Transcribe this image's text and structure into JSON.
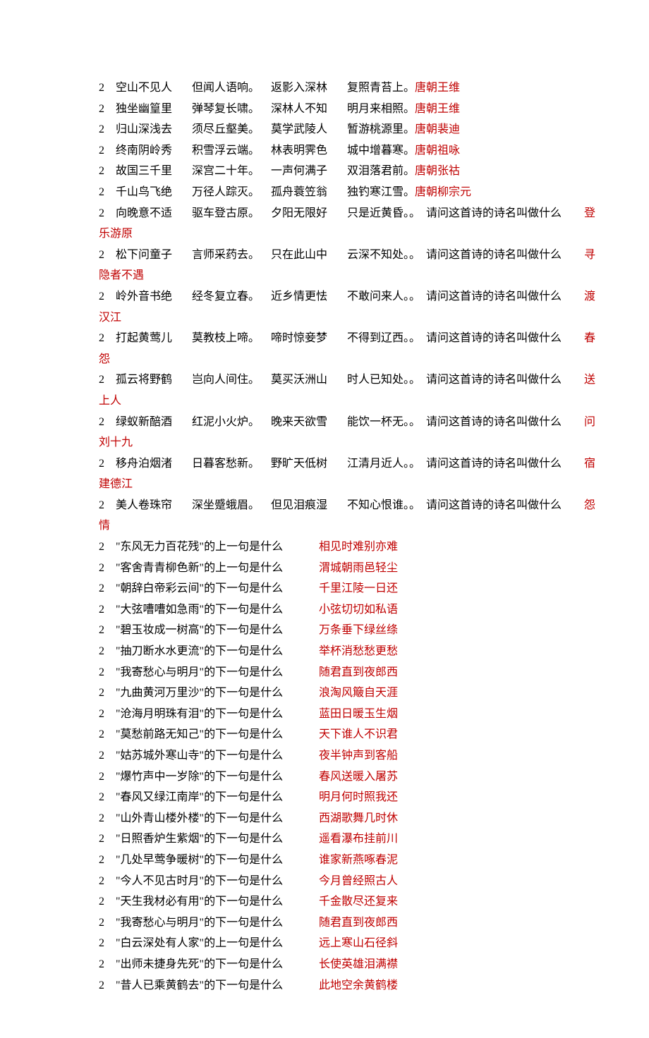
{
  "lines": [
    {
      "type": "author",
      "num": "2",
      "a": "空山不见人",
      "b": "但闻人语响。",
      "c": "返影入深林",
      "d": "复照青苔上。",
      "e": " 唐朝王维"
    },
    {
      "type": "author",
      "num": "2",
      "a": "独坐幽篁里",
      "b": "弹琴复长啸。",
      "c": "深林人不知",
      "d": "明月来相照。",
      "e": " 唐朝王维"
    },
    {
      "type": "author",
      "num": "2",
      "a": "归山深浅去",
      "b": "须尽丘壑美。",
      "c": "莫学武陵人",
      "d": "暂游桃源里。",
      "e": " 唐朝裴迪"
    },
    {
      "type": "author",
      "num": "2",
      "a": "终南阴岭秀",
      "b": "积雪浮云端。",
      "c": "林表明霁色",
      "d": "城中增暮寒。",
      "e": " 唐朝祖咏"
    },
    {
      "type": "author",
      "num": "2",
      "a": "故国三千里",
      "b": "深宫二十年。",
      "c": "一声何满子",
      "d": "双泪落君前。",
      "e": " 唐朝张祜"
    },
    {
      "type": "author",
      "num": "2",
      "a": "千山鸟飞绝",
      "b": "万径人踪灭。",
      "c": " 孤舟蓑笠翁",
      "d": "独钓寒江雪。",
      "e": " 唐朝柳宗元"
    },
    {
      "type": "title",
      "num": "2",
      "a": "向晚意不适",
      "b": "驱车登古原。",
      "c": "夕阳无限好",
      "d": "只是近黄昏。",
      "q": "请问这首诗的诗名叫做什么",
      "ans": "登乐游原"
    },
    {
      "type": "title",
      "num": "2",
      "a": "松下问童子",
      "b": "言师采药去。",
      "c": "只在此山中",
      "d": "云深不知处。",
      "q": "请问这首诗的诗名叫做什么",
      "ans": "寻隐者不遇"
    },
    {
      "type": "title",
      "num": "2",
      "a": "岭外音书绝",
      "b": "经冬复立春。",
      "c": "近乡情更怯",
      "d": "不敢问来人。",
      "q": "请问这首诗的诗名叫做什么",
      "ans": "渡汉江"
    },
    {
      "type": "title",
      "num": "2",
      "a": "打起黄莺儿",
      "b": "莫教枝上啼。",
      "c": "啼时惊妾梦",
      "d": "不得到辽西。",
      "q": "请问这首诗的诗名叫做什么",
      "ans": "春怨"
    },
    {
      "type": "title",
      "num": "2",
      "a": "孤云将野鹤",
      "b": "岂向人间住。",
      "c": "莫买沃洲山",
      "d": "时人已知处。",
      "q": "请问这首诗的诗名叫做什么",
      "ans": "送上人"
    },
    {
      "type": "title",
      "num": "2",
      "a": "绿蚁新醅酒",
      "b": "红泥小火炉。",
      "c": "晚来天欲雪",
      "d": "能饮一杯无。",
      "q": "请问这首诗的诗名叫做什么",
      "ans": "问刘十九"
    },
    {
      "type": "title",
      "num": "2",
      "a": "移舟泊烟渚",
      "b": "日暮客愁新。",
      "c": "野旷天低树",
      "d": "江清月近人。",
      "q": "请问这首诗的诗名叫做什么",
      "ans": "宿建德江"
    },
    {
      "type": "title",
      "num": "2",
      "a": "美人卷珠帘",
      "b": "深坐蹙蛾眉。",
      "c": "但见泪痕湿",
      "d": "不知心恨谁。",
      "q": "请问这首诗的诗名叫做什么",
      "ans": "怨情"
    },
    {
      "type": "verse",
      "num": "2",
      "q": "\"东风无力百花残\"的上一句是什么",
      "ans": "相见时难别亦难"
    },
    {
      "type": "verse",
      "num": "2",
      "q": "\"客舍青青柳色新\"的上一句是什么",
      "ans": "渭城朝雨邑轻尘"
    },
    {
      "type": "verse",
      "num": "2",
      "q": "\"朝辞白帝彩云间\"的下一句是什么",
      "ans": "千里江陵一日还"
    },
    {
      "type": "verse",
      "num": "2",
      "q": "\"大弦嘈嘈如急雨\"的下一句是什么",
      "ans": "小弦切切如私语"
    },
    {
      "type": "verse",
      "num": "2",
      "q": "\"碧玉妆成一树高\"的下一句是什么",
      "ans": "万条垂下绿丝绦"
    },
    {
      "type": "verse",
      "num": "2",
      "q": "\"抽刀断水水更流\"的下一句是什么",
      "ans": "举杯消愁愁更愁"
    },
    {
      "type": "verse",
      "num": "2",
      "q": "\"我寄愁心与明月\"的下一句是什么",
      "ans": "随君直到夜郎西"
    },
    {
      "type": "verse",
      "num": "2",
      "q": "\"九曲黄河万里沙\"的下一句是什么",
      "ans": "浪淘风簸自天涯"
    },
    {
      "type": "verse",
      "num": "2",
      "q": "\"沧海月明珠有泪\"的下一句是什么",
      "ans": "蓝田日暖玉生烟"
    },
    {
      "type": "verse",
      "num": "2",
      "q": "\"莫愁前路无知己\"的下一句是什么",
      "ans": "天下谁人不识君"
    },
    {
      "type": "verse",
      "num": "2",
      "q": "\"姑苏城外寒山寺\"的下一句是什么",
      "ans": "夜半钟声到客船"
    },
    {
      "type": "verse",
      "num": "2",
      "q": "\"爆竹声中一岁除\"的下一句是什么",
      "ans": "春风送暖入屠苏"
    },
    {
      "type": "verse",
      "num": "2",
      "q": "\"春风又绿江南岸\"的下一句是什么",
      "ans": "明月何时照我还"
    },
    {
      "type": "verse",
      "num": "2",
      "q": "\"山外青山楼外楼\"的下一句是什么",
      "ans": "西湖歌舞几时休"
    },
    {
      "type": "verse",
      "num": "2",
      "q": "\"日照香炉生紫烟\"的下一句是什么",
      "ans": "遥看瀑布挂前川"
    },
    {
      "type": "verse",
      "num": "2",
      "q": "\"几处早莺争暖树\"的下一句是什么",
      "ans": "谁家新燕啄春泥"
    },
    {
      "type": "verse",
      "num": "2",
      "q": "\"今人不见古时月\"的下一句是什么",
      "ans": "今月曾经照古人"
    },
    {
      "type": "verse",
      "num": "2",
      "q": "\"天生我材必有用\"的下一句是什么",
      "ans": "千金散尽还复来"
    },
    {
      "type": "verse",
      "num": "2",
      "q": "\"我寄愁心与明月\"的下一句是什么",
      "ans": "随君直到夜郎西"
    },
    {
      "type": "verse",
      "num": "2",
      "q": "\"白云深处有人家\"的上一句是什么",
      "ans": "远上寒山石径斜"
    },
    {
      "type": "verse",
      "num": "2",
      "q": "\"出师未捷身先死\"的下一句是什么",
      "ans": "长使英雄泪满襟"
    },
    {
      "type": "verse",
      "num": "2",
      "q": "\"昔人已乘黄鹤去\"的下一句是什么",
      "ans": "此地空余黄鹤楼"
    }
  ]
}
